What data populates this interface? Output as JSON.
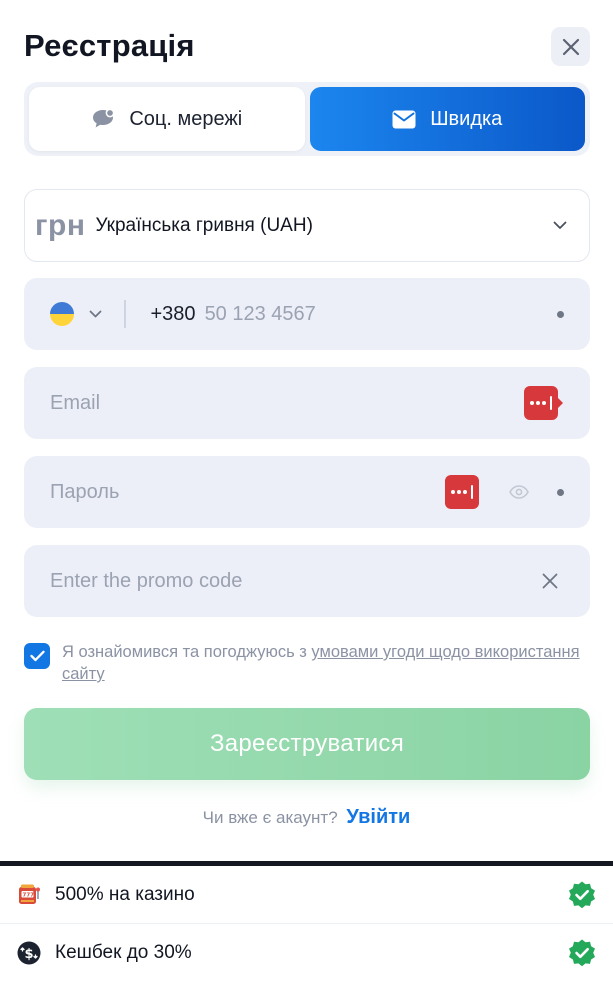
{
  "header": {
    "title": "Реєстрація",
    "close_icon": "close-icon"
  },
  "tabs": [
    {
      "label": "Соц. мережі",
      "icon": "chat-bubble-icon",
      "active": false
    },
    {
      "label": "Швидка",
      "icon": "envelope-icon",
      "active": true
    }
  ],
  "currency": {
    "symbol": "грн",
    "name": "Українська гривня (UAH)"
  },
  "phone": {
    "country_flag": "ukraine-flag-icon",
    "prefix": "+380",
    "placeholder": "50 123 4567"
  },
  "email": {
    "placeholder": "Email"
  },
  "password": {
    "placeholder": "Пароль"
  },
  "promo": {
    "placeholder": "Enter the promo code"
  },
  "agreement": {
    "checked": true,
    "text": "Я ознайомився та погоджуюсь з ",
    "link": "умовами угоди щодо використання сайту"
  },
  "submit": {
    "label": "Зареєструватися"
  },
  "login": {
    "question": "Чи вже є акаунт?",
    "link": "Увійти"
  },
  "bonuses": [
    {
      "icon": "slot-machine-icon",
      "text": "500% на казино"
    },
    {
      "icon": "cashback-coin-icon",
      "text": "Кешбек до 30%"
    }
  ],
  "colors": {
    "primary_blue": "#1377e3",
    "tab_gradient_start": "#1c86ee",
    "tab_gradient_end": "#0b58c9",
    "submit_green": "#8ad3a3",
    "field_bg": "#eceff7",
    "check_badge_green": "#24a85a",
    "password_manager_red": "#d6383b",
    "flag_blue": "#3f7ad6",
    "flag_yellow": "#ffd43b"
  }
}
